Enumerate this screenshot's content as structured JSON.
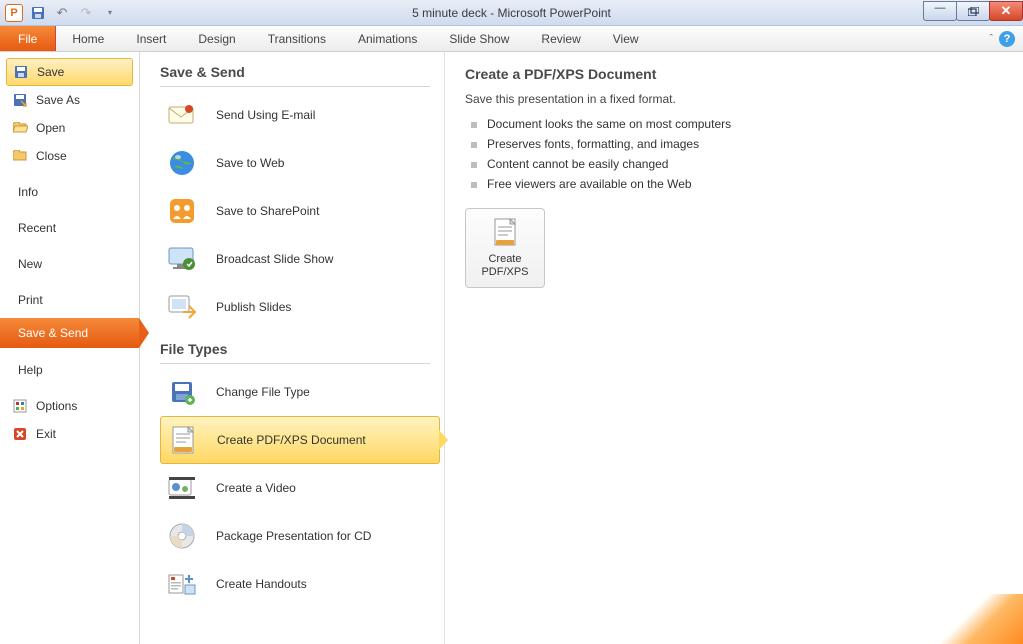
{
  "title": "5 minute deck - Microsoft PowerPoint",
  "ribbon": {
    "file": "File",
    "tabs": [
      "Home",
      "Insert",
      "Design",
      "Transitions",
      "Animations",
      "Slide Show",
      "Review",
      "View"
    ]
  },
  "sidebar": {
    "save": "Save",
    "save_as": "Save As",
    "open": "Open",
    "close": "Close",
    "info": "Info",
    "recent": "Recent",
    "new": "New",
    "print": "Print",
    "save_send": "Save & Send",
    "help": "Help",
    "options": "Options",
    "exit": "Exit"
  },
  "mid": {
    "section1": "Save & Send",
    "items1": [
      "Send Using E-mail",
      "Save to Web",
      "Save to SharePoint",
      "Broadcast Slide Show",
      "Publish Slides"
    ],
    "section2": "File Types",
    "items2": [
      "Change File Type",
      "Create PDF/XPS Document",
      "Create a Video",
      "Package Presentation for CD",
      "Create Handouts"
    ]
  },
  "detail": {
    "heading": "Create a PDF/XPS Document",
    "subtitle": "Save this presentation in a fixed format.",
    "bullets": [
      "Document looks the same on most computers",
      "Preserves fonts, formatting, and images",
      "Content cannot be easily changed",
      "Free viewers are available on the Web"
    ],
    "button_l1": "Create",
    "button_l2": "PDF/XPS"
  }
}
